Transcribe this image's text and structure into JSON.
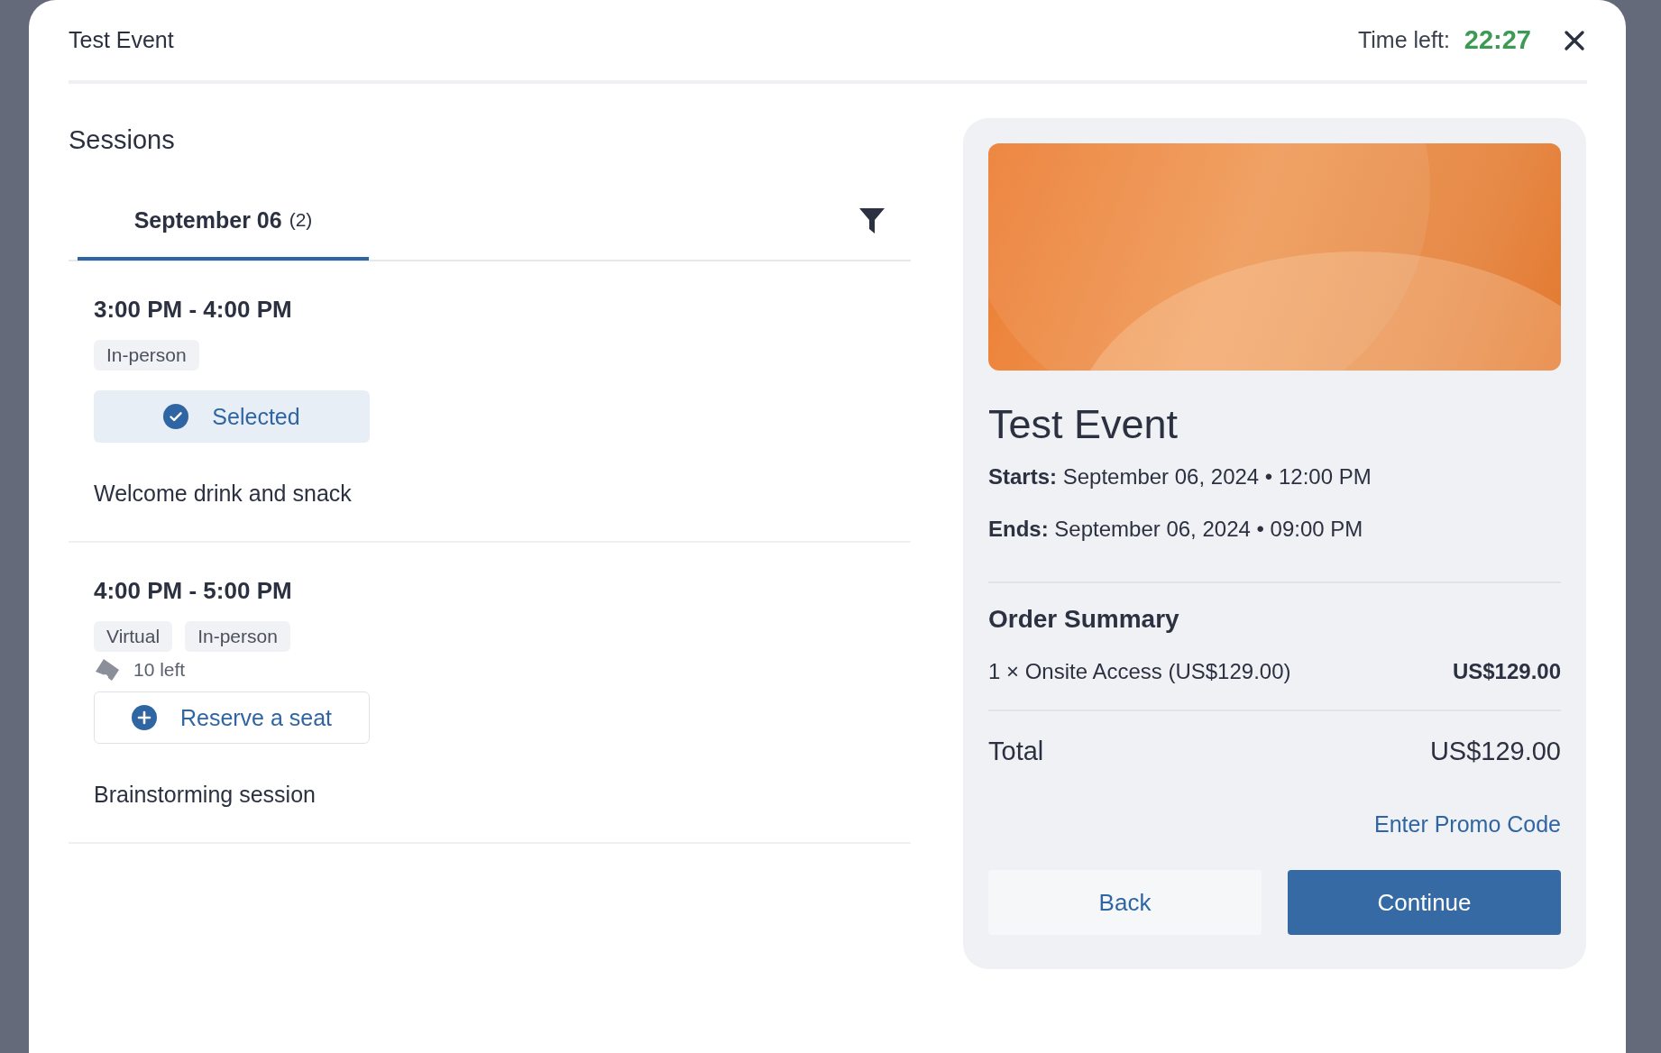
{
  "header": {
    "title": "Test Event",
    "timer_label": "Time left:",
    "timer_value": "22:27"
  },
  "sessions_panel": {
    "heading": "Sessions",
    "tabs": [
      {
        "label": "September 06",
        "count": "(2)",
        "selected": true
      }
    ],
    "sessions": [
      {
        "time": "3:00 PM - 4:00 PM",
        "tags": [
          "In-person"
        ],
        "selected": true,
        "action": "Selected",
        "description": "Welcome drink and snack"
      },
      {
        "time": "4:00 PM - 5:00 PM",
        "tags": [
          "Virtual",
          "In-person"
        ],
        "seats_left": "10 left",
        "selected": false,
        "action": "Reserve a seat",
        "description": "Brainstorming session"
      }
    ]
  },
  "summary": {
    "title": "Test Event",
    "dates": [
      {
        "label": "Starts:",
        "value": "September 06, 2024 • 12:00 PM"
      },
      {
        "label": "Ends:",
        "value": "September 06, 2024 • 09:00 PM"
      }
    ],
    "order_heading": "Order Summary",
    "lines": [
      {
        "item": "1 × Onsite Access (US$129.00)",
        "amount": "US$129.00"
      }
    ],
    "total_label": "Total",
    "total_value": "US$129.00",
    "promo_link": "Enter Promo Code",
    "buttons": [
      {
        "label": "Back",
        "kind": "secondary"
      },
      {
        "label": "Continue",
        "kind": "primary"
      }
    ]
  }
}
